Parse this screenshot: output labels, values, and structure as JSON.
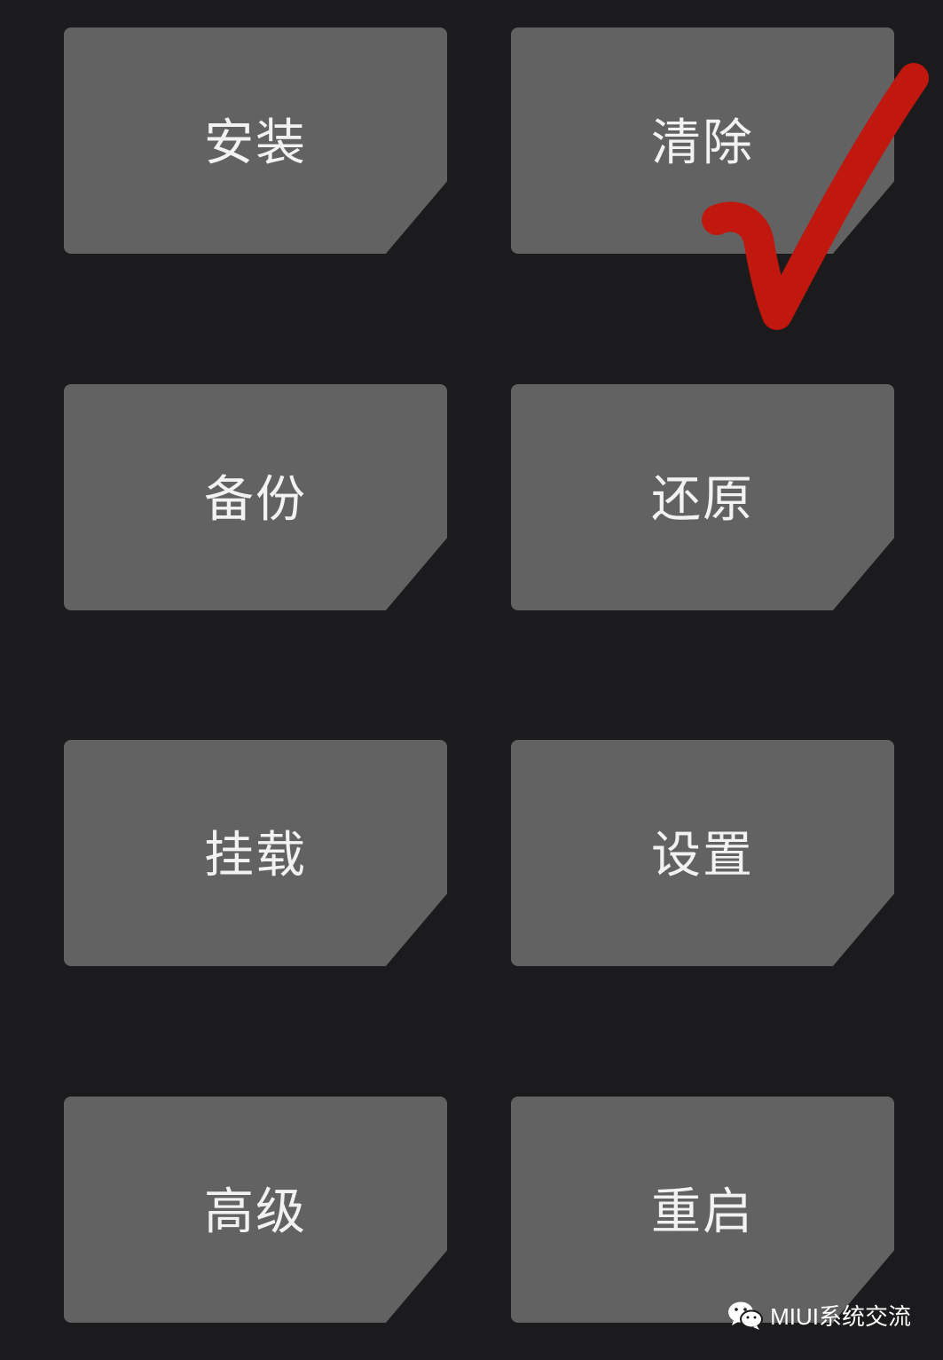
{
  "buttons": [
    {
      "label": "安装"
    },
    {
      "label": "清除"
    },
    {
      "label": "备份"
    },
    {
      "label": "还原"
    },
    {
      "label": "挂载"
    },
    {
      "label": "设置"
    },
    {
      "label": "高级"
    },
    {
      "label": "重启"
    }
  ],
  "annotation": {
    "icon": "checkmark-icon",
    "color": "#c0170f"
  },
  "watermark": {
    "icon": "wechat-icon",
    "text": "MIUI系统交流"
  },
  "colors": {
    "background": "#1b1b1d",
    "tile": "#626263",
    "label": "#f2f2f2"
  }
}
